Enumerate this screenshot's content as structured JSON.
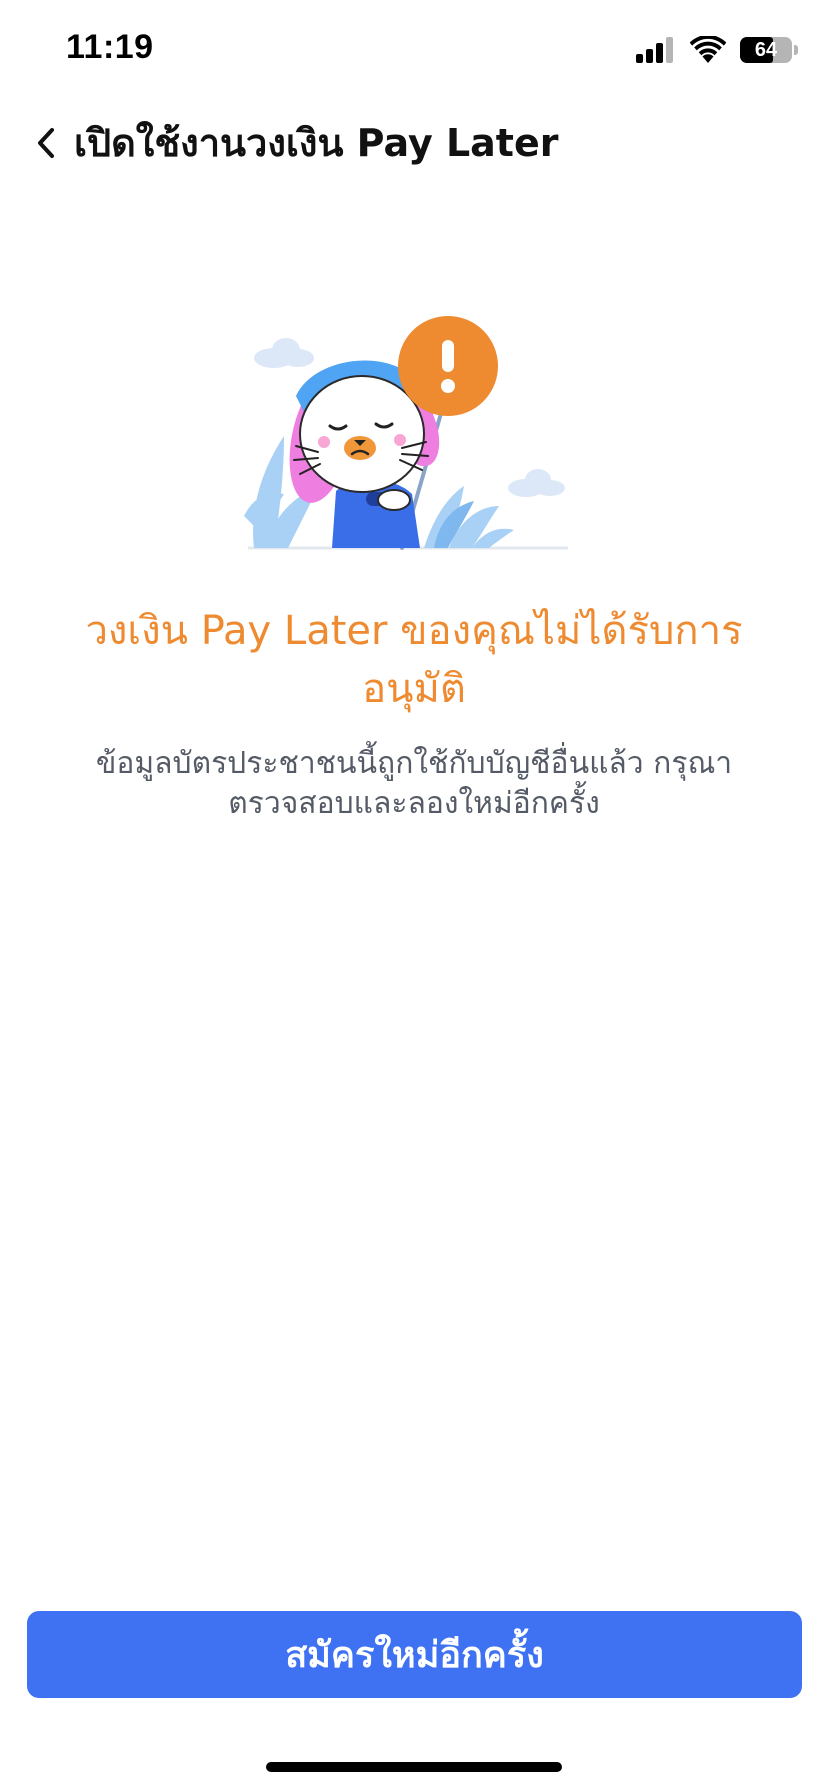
{
  "status_bar": {
    "time": "11:19",
    "battery_level": "64",
    "battery_fraction": 0.64
  },
  "header": {
    "back_icon": "chevron-left-icon",
    "title": "เปิดใช้งานวงเงิน Pay Later"
  },
  "illustration": {
    "alert_icon": "exclamation-icon",
    "accent_color": "#ee8a30"
  },
  "result": {
    "title": "วงเงิน Pay Later ของคุณไม่ได้รับการอนุมัติ",
    "message": "ข้อมูลบัตรประชาชนนี้ถูกใช้กับบัญชีอื่นแล้ว กรุณาตรวจสอบและลองใหม่อีกครั้ง"
  },
  "actions": {
    "retry_label": "สมัครใหม่อีกครั้ง"
  },
  "colors": {
    "primary": "#3f72f2",
    "warning": "#ee8a30",
    "text_secondary": "#555b66"
  }
}
